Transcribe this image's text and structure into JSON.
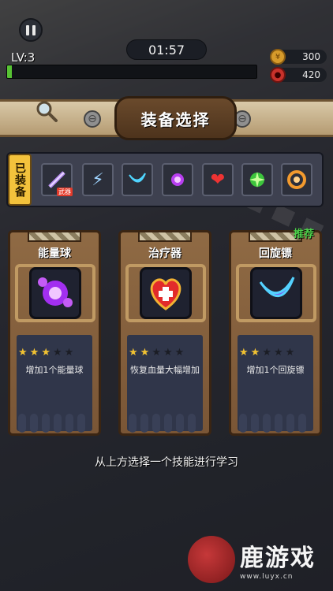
{
  "hud": {
    "timer": "01:57",
    "level": "LV:3",
    "xp_progress_percent": 2,
    "gold": "300",
    "gems": "420"
  },
  "dialog": {
    "title": "装备选择",
    "equipped_label": "已装备",
    "weapon_tag": "武器",
    "equipped_slots": [
      "sword-icon",
      "lightning-icon",
      "boomerang-icon",
      "energy-orb-icon",
      "healer-icon",
      "green-burst-icon",
      "vortex-icon"
    ],
    "recommend_badge": "推荐",
    "cards": [
      {
        "name": "能量球",
        "icon": "energy-orb-icon",
        "stars": 3,
        "max_stars": 5,
        "description": "增加1个能量球"
      },
      {
        "name": "治疗器",
        "icon": "healer-icon",
        "stars": 2,
        "max_stars": 5,
        "description": "恢复血量大幅增加"
      },
      {
        "name": "回旋镖",
        "icon": "boomerang-icon",
        "stars": 2,
        "max_stars": 5,
        "description": "增加1个回旋镖"
      }
    ],
    "hint": "从上方选择一个技能进行学习"
  },
  "watermark": {
    "title": "鹿游戏",
    "url": "www.luyx.cn"
  }
}
